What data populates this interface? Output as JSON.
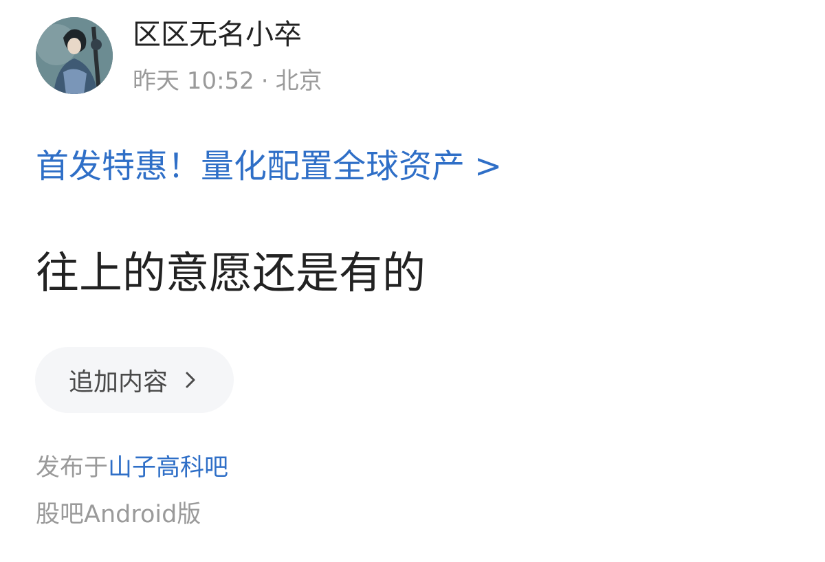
{
  "author": {
    "name": "区区无名小卒",
    "avatar_icon": "avatar-illustration-icon"
  },
  "meta": {
    "time": "昨天 10:52",
    "separator": "·",
    "location": "北京"
  },
  "promo": {
    "text": "首发特惠！量化配置全球资产",
    "chevron": ">"
  },
  "post": {
    "text": "往上的意愿还是有的"
  },
  "append_button": {
    "label": "追加内容",
    "icon": "chevron-right-icon"
  },
  "published": {
    "prefix": "发布于",
    "bar_name": "山子高科吧"
  },
  "client": {
    "text": "股吧Android版"
  },
  "colors": {
    "link": "#2f6fc7",
    "text": "#222222",
    "muted": "#9a9a9a",
    "button_bg": "#f5f6f8"
  }
}
